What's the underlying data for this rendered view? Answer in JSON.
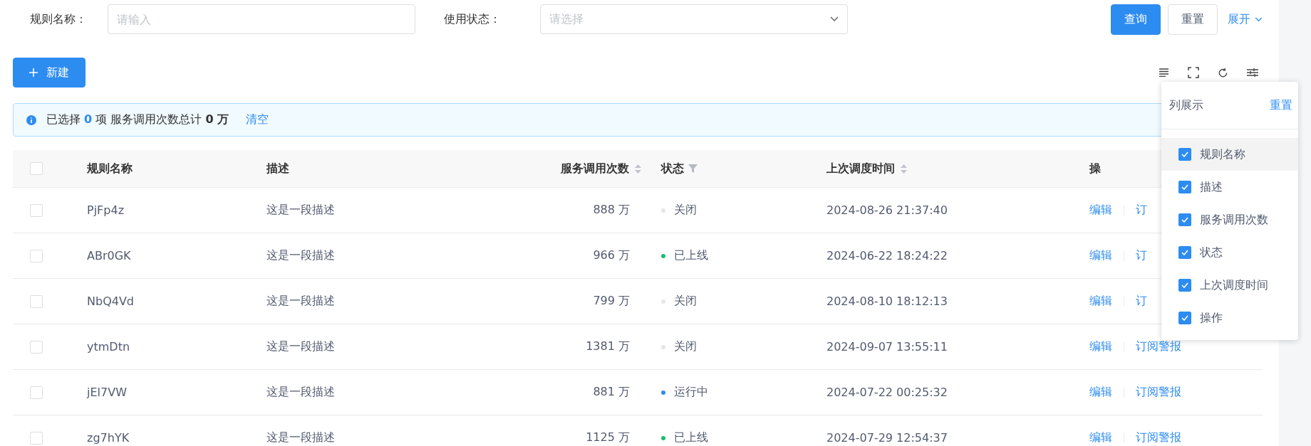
{
  "filters": [
    {
      "kind": "input",
      "label": "规则名称：",
      "placeholder": "请输入"
    },
    {
      "kind": "select",
      "label": "使用状态：",
      "placeholder": "请选择"
    }
  ],
  "filter_buttons": {
    "query": "查询",
    "reset": "重置",
    "expand": "展开"
  },
  "toolbar": {
    "new_button": "新建"
  },
  "alert": {
    "parts": [
      "已选择",
      "0",
      "项 服务调用次数总计",
      "0 万"
    ],
    "clear": "清空"
  },
  "table": {
    "select_all_checked": false,
    "columns": [
      {
        "label": "规则名称",
        "kind": "plain"
      },
      {
        "label": "描述",
        "kind": "plain"
      },
      {
        "label": "服务调用次数",
        "kind": "sort"
      },
      {
        "label": "状态",
        "kind": "filter"
      },
      {
        "label": "上次调度时间",
        "kind": "sort"
      },
      {
        "label": "操",
        "kind": "plain"
      }
    ],
    "rows": [
      {
        "checked": false,
        "name": "PjFp4z",
        "desc": "这是一段描述",
        "count": "888 万",
        "status": "关闭",
        "color": "#e3e6eb",
        "time": "2024-08-26 21:37:40",
        "actions": [
          "编辑",
          "订"
        ]
      },
      {
        "checked": false,
        "name": "ABr0GK",
        "desc": "这是一段描述",
        "count": "966 万",
        "status": "已上线",
        "color": "#19be6b",
        "time": "2024-06-22 18:24:22",
        "actions": [
          "编辑",
          "订"
        ]
      },
      {
        "checked": false,
        "name": "NbQ4Vd",
        "desc": "这是一段描述",
        "count": "799 万",
        "status": "关闭",
        "color": "#e3e6eb",
        "time": "2024-08-10 18:12:13",
        "actions": [
          "编辑",
          "订"
        ]
      },
      {
        "checked": false,
        "name": "ytmDtn",
        "desc": "这是一段描述",
        "count": "1381 万",
        "status": "关闭",
        "color": "#e3e6eb",
        "time": "2024-09-07 13:55:11",
        "actions": [
          "编辑",
          "订阅警报"
        ]
      },
      {
        "checked": false,
        "name": "jEl7VW",
        "desc": "这是一段描述",
        "count": "881 万",
        "status": "运行中",
        "color": "#2d8cf0",
        "time": "2024-07-22 00:25:32",
        "actions": [
          "编辑",
          "订阅警报"
        ]
      },
      {
        "checked": false,
        "name": "zg7hYK",
        "desc": "这是一段描述",
        "count": "1125 万",
        "status": "已上线",
        "color": "#19be6b",
        "time": "2024-07-29 12:54:37",
        "actions": [
          "编辑",
          "订阅警报"
        ]
      }
    ]
  },
  "column_popover": {
    "title": "列展示",
    "reset": "重置",
    "items": [
      {
        "label": "规则名称",
        "checked": true,
        "selected": true
      },
      {
        "label": "描述",
        "checked": true,
        "selected": false
      },
      {
        "label": "服务调用次数",
        "checked": true,
        "selected": false
      },
      {
        "label": "状态",
        "checked": true,
        "selected": false
      },
      {
        "label": "上次调度时间",
        "checked": true,
        "selected": false
      },
      {
        "label": "操作",
        "checked": true,
        "selected": false
      }
    ]
  }
}
